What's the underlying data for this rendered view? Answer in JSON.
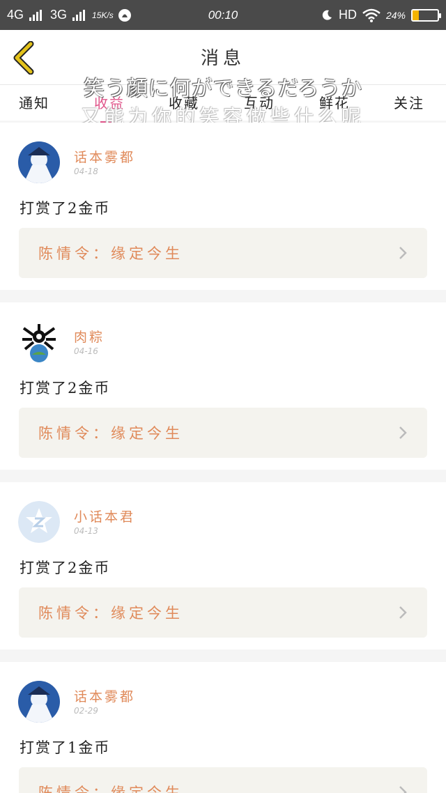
{
  "status_bar": {
    "network1": "4G",
    "network2": "3G",
    "speed": "15K/s",
    "time": "00:10",
    "hd": "HD",
    "battery_text": "24%",
    "battery_level": 0.24
  },
  "header": {
    "title": "消息",
    "back_icon": "chevron-left-icon",
    "back_color": "#d9b400"
  },
  "tabs": [
    {
      "label": "通知"
    },
    {
      "label": "收益"
    },
    {
      "label": "收藏"
    },
    {
      "label": "互动"
    },
    {
      "label": "鲜花"
    },
    {
      "label": "关注"
    }
  ],
  "active_tab": "收益",
  "overlay": {
    "line1": "笑う顔に何ができるだろうか",
    "line2": "又能为你的笑容做些什么呢"
  },
  "items": [
    {
      "user": "话本雾都",
      "date": "04-18",
      "text": "打赏了2金币",
      "work": "陈情令：缘定今生"
    },
    {
      "user": "肉粽",
      "date": "04-16",
      "text": "打赏了2金币",
      "work": "陈情令：缘定今生"
    },
    {
      "user": "小话本君",
      "date": "04-13",
      "text": "打赏了2金币",
      "work": "陈情令：缘定今生"
    },
    {
      "user": "话本雾都",
      "date": "02-29",
      "text": "打赏了1金币",
      "work": "陈情令：缘定今生"
    }
  ],
  "colors": {
    "accent": "#e0558a",
    "username": "#e08a5a",
    "card_link_bg": "#f4f3ee"
  }
}
